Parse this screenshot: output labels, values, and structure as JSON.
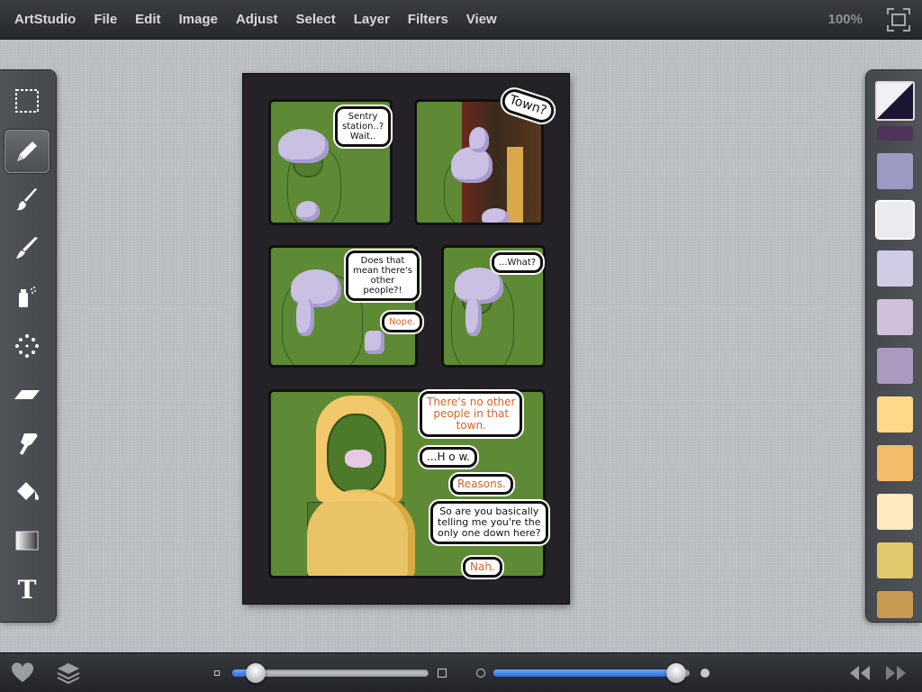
{
  "menubar": {
    "app_name": "ArtStudio",
    "items": [
      "File",
      "Edit",
      "Image",
      "Adjust",
      "Select",
      "Layer",
      "Filters",
      "View"
    ],
    "zoom": "100%"
  },
  "tools": [
    {
      "name": "selection-tool",
      "icon": "marquee-icon",
      "active": false
    },
    {
      "name": "pencil-tool",
      "icon": "pencil-icon",
      "active": true
    },
    {
      "name": "paintbrush-tool",
      "icon": "brush-icon",
      "active": false
    },
    {
      "name": "smudge-tool",
      "icon": "smudge-brush-icon",
      "active": false
    },
    {
      "name": "spray-tool",
      "icon": "spray-can-icon",
      "active": false
    },
    {
      "name": "scatter-tool",
      "icon": "dots-icon",
      "active": false
    },
    {
      "name": "eraser-tool",
      "icon": "eraser-icon",
      "active": false
    },
    {
      "name": "smudge-finger-tool",
      "icon": "finger-icon",
      "active": false
    },
    {
      "name": "fill-tool",
      "icon": "paint-bucket-icon",
      "active": false
    },
    {
      "name": "gradient-tool",
      "icon": "gradient-icon",
      "active": false
    },
    {
      "name": "text-tool",
      "icon": "text-icon",
      "active": false
    }
  ],
  "palette": {
    "current": {
      "primary": "#1c1533",
      "secondary": "#f3eff7"
    },
    "swatches": [
      "#4e3457",
      "#9c9ac2",
      "#eceaf1",
      "#cfcde5",
      "#d2bfdb",
      "#ad98bf",
      "#ffd88a",
      "#f3bb6a",
      "#ffe9bf",
      "#e3c96e",
      "#c99a51"
    ],
    "selected_index": 2
  },
  "comic": {
    "bubbles": [
      "Sentry\nstation..?\nWait..",
      "Town?",
      "Does that\nmean there's\nother\npeople?!",
      "Nope.",
      "...What?",
      "There's no other\npeople in that\ntown.",
      "...H o w.",
      "Reasons.",
      "So are you basically\ntelling me you're the\nonly one down here?",
      "Nah."
    ]
  },
  "bottombar": {
    "brush_size": 0.12,
    "opacity": 0.93,
    "icons": [
      "heart-icon",
      "layers-icon",
      "undo-icon",
      "redo-icon"
    ]
  }
}
